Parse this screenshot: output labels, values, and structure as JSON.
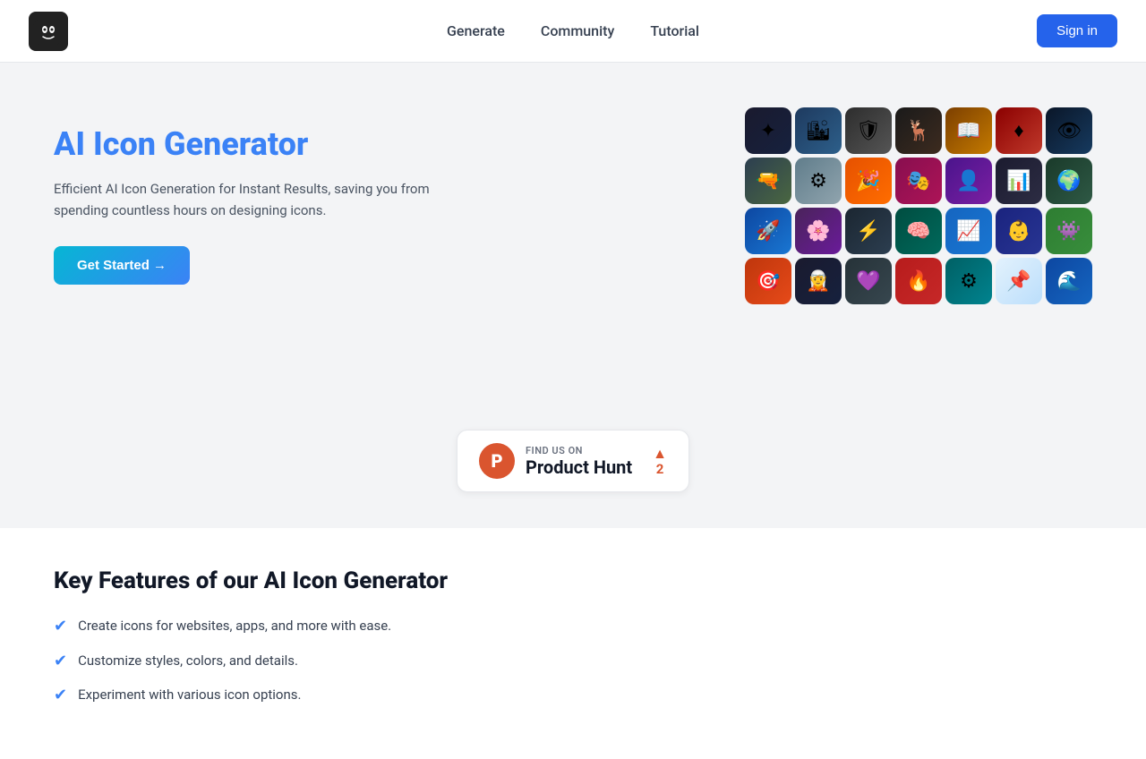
{
  "nav": {
    "links": [
      {
        "label": "Generate",
        "id": "generate"
      },
      {
        "label": "Community",
        "id": "community"
      },
      {
        "label": "Tutorial",
        "id": "tutorial"
      }
    ],
    "signin_label": "Sign in"
  },
  "hero": {
    "title": "AI Icon Generator",
    "description": "Efficient AI Icon Generation for Instant Results, saving you from spending countless hours on designing icons.",
    "cta_label": "Get Started →"
  },
  "product_hunt": {
    "find_us": "FIND US ON",
    "name": "Product Hunt",
    "logo_letter": "P",
    "vote_count": "2"
  },
  "features": {
    "title": "Key Features of our AI Icon Generator",
    "items": [
      {
        "text": "Create icons for websites, apps, and more with ease."
      },
      {
        "text": "Customize styles, colors, and details."
      },
      {
        "text": "Experiment with various icon options."
      }
    ]
  },
  "icons": [
    {
      "emoji": "✦",
      "class": "ic-1"
    },
    {
      "emoji": "🏙",
      "class": "ic-2"
    },
    {
      "emoji": "🛡",
      "class": "ic-3"
    },
    {
      "emoji": "🦌",
      "class": "ic-4"
    },
    {
      "emoji": "📖",
      "class": "ic-5"
    },
    {
      "emoji": "♦",
      "class": "ic-6"
    },
    {
      "emoji": "👁",
      "class": "ic-7"
    },
    {
      "emoji": "🔫",
      "class": "ic-8"
    },
    {
      "emoji": "⚙",
      "class": "ic-9"
    },
    {
      "emoji": "🎉",
      "class": "ic-10"
    },
    {
      "emoji": "🎭",
      "class": "ic-11"
    },
    {
      "emoji": "👤",
      "class": "ic-12"
    },
    {
      "emoji": "📊",
      "class": "ic-13"
    },
    {
      "emoji": "🌍",
      "class": "ic-14"
    },
    {
      "emoji": "🚀",
      "class": "ic-15"
    },
    {
      "emoji": "🌸",
      "class": "ic-16"
    },
    {
      "emoji": "⚡",
      "class": "ic-17"
    },
    {
      "emoji": "🧠",
      "class": "ic-18"
    },
    {
      "emoji": "📈",
      "class": "ic-19"
    },
    {
      "emoji": "👶",
      "class": "ic-20"
    },
    {
      "emoji": "👾",
      "class": "ic-21"
    },
    {
      "emoji": "🎯",
      "class": "ic-22"
    },
    {
      "emoji": "🧝",
      "class": "ic-23"
    },
    {
      "emoji": "💜",
      "class": "ic-24"
    },
    {
      "emoji": "🔥",
      "class": "ic-25"
    },
    {
      "emoji": "⚙",
      "class": "ic-26"
    },
    {
      "emoji": "📌",
      "class": "ic-27"
    },
    {
      "emoji": "🌊",
      "class": "ic-28"
    }
  ]
}
